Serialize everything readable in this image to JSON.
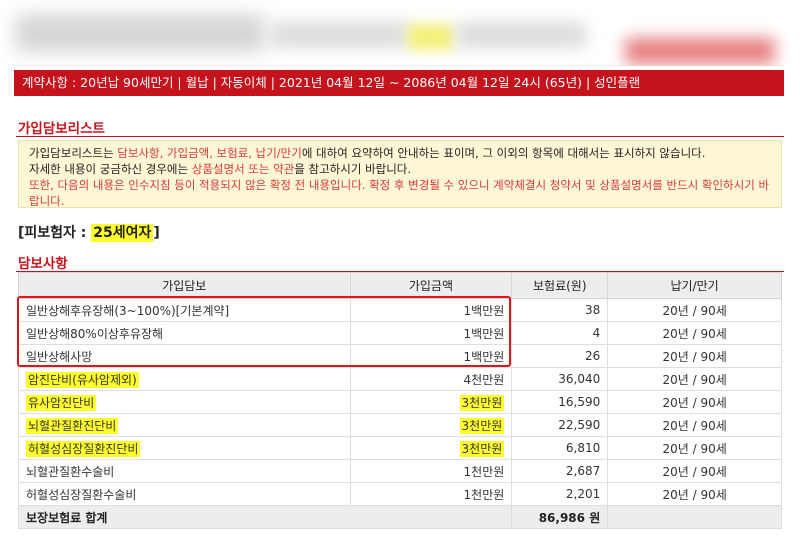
{
  "contract_bar": "계약사항 : 20년납 90세만기 | 월납 | 자동이체 | 2021년 04월 12일 ~ 2086년 04월 12일 24시 (65년) | 성인플랜",
  "list_section": {
    "title": "가입담보리스트",
    "info_lines": [
      "가입담보리스트는 담보사항, 가입금액, 보험료, 납기/만기에 대하여 요약하여 안내하는 표이며, 그 이외의 항목에 대해서는 표시하지 않습니다.",
      "자세한 내용이 궁금하신 경우에는 상품설명서 또는 약관을 참고하시기 바랍니다.",
      "또한, 다음의 내용은 인수지침 등이 적용되지 않은 확정 전 내용입니다. 확정 후 변경될 수 있으니 계약체결시 청약서 및 상품설명서를 반드시 확인하시기 바랍니다."
    ],
    "info_line1_prefix": "가입담보리스트는 ",
    "info_line1_red": "담보사항, 가입금액, 보험료, 납기/만기",
    "info_line1_suffix": "에 대하여 요약하여 안내하는 표이며, 그 이외의 항목에 대해서는 표시하지 않습니다.",
    "info_line2_prefix": "자세한 내용이 궁금하신 경우에는 ",
    "info_line2_red": "상품설명서 또는 약관",
    "info_line2_suffix": "을 참고하시기 바랍니다."
  },
  "insured": {
    "prefix": "[피보험자 : ",
    "value": "25세여자",
    "suffix": "]"
  },
  "coverage": {
    "title": "담보사항",
    "headers": [
      "가입담보",
      "가입금액",
      "보험료(원)",
      "납기/만기"
    ],
    "rows": [
      {
        "name": "일반상해후유장해(3~100%)[기본계약]",
        "amount": "1백만원",
        "premium": "38",
        "term": "20년 / 90세"
      },
      {
        "name": "일반상해80%이상후유장해",
        "amount": "1백만원",
        "premium": "4",
        "term": "20년 / 90세"
      },
      {
        "name": "일반상해사망",
        "amount": "1백만원",
        "premium": "26",
        "term": "20년 / 90세"
      },
      {
        "name": "암진단비(유사암제외)",
        "amount": "4천만원",
        "premium": "36,040",
        "term": "20년 / 90세"
      },
      {
        "name": "유사암진단비",
        "amount": "3천만원",
        "premium": "16,590",
        "term": "20년 / 90세"
      },
      {
        "name": "뇌혈관질환진단비",
        "amount": "3천만원",
        "premium": "22,590",
        "term": "20년 / 90세"
      },
      {
        "name": "허혈성심장질환진단비",
        "amount": "3천만원",
        "premium": "6,810",
        "term": "20년 / 90세"
      },
      {
        "name": "뇌혈관질환수술비",
        "amount": "1천만원",
        "premium": "2,687",
        "term": "20년 / 90세"
      },
      {
        "name": "허혈성심장질환수술비",
        "amount": "1천만원",
        "premium": "2,201",
        "term": "20년 / 90세"
      }
    ],
    "total_label": "보장보험료 합계",
    "total_value": "86,986 원"
  },
  "colors": {
    "accent_red": "#c4131c",
    "highlight_yellow": "#ffff2e",
    "info_bg": "#fdf7d5"
  }
}
